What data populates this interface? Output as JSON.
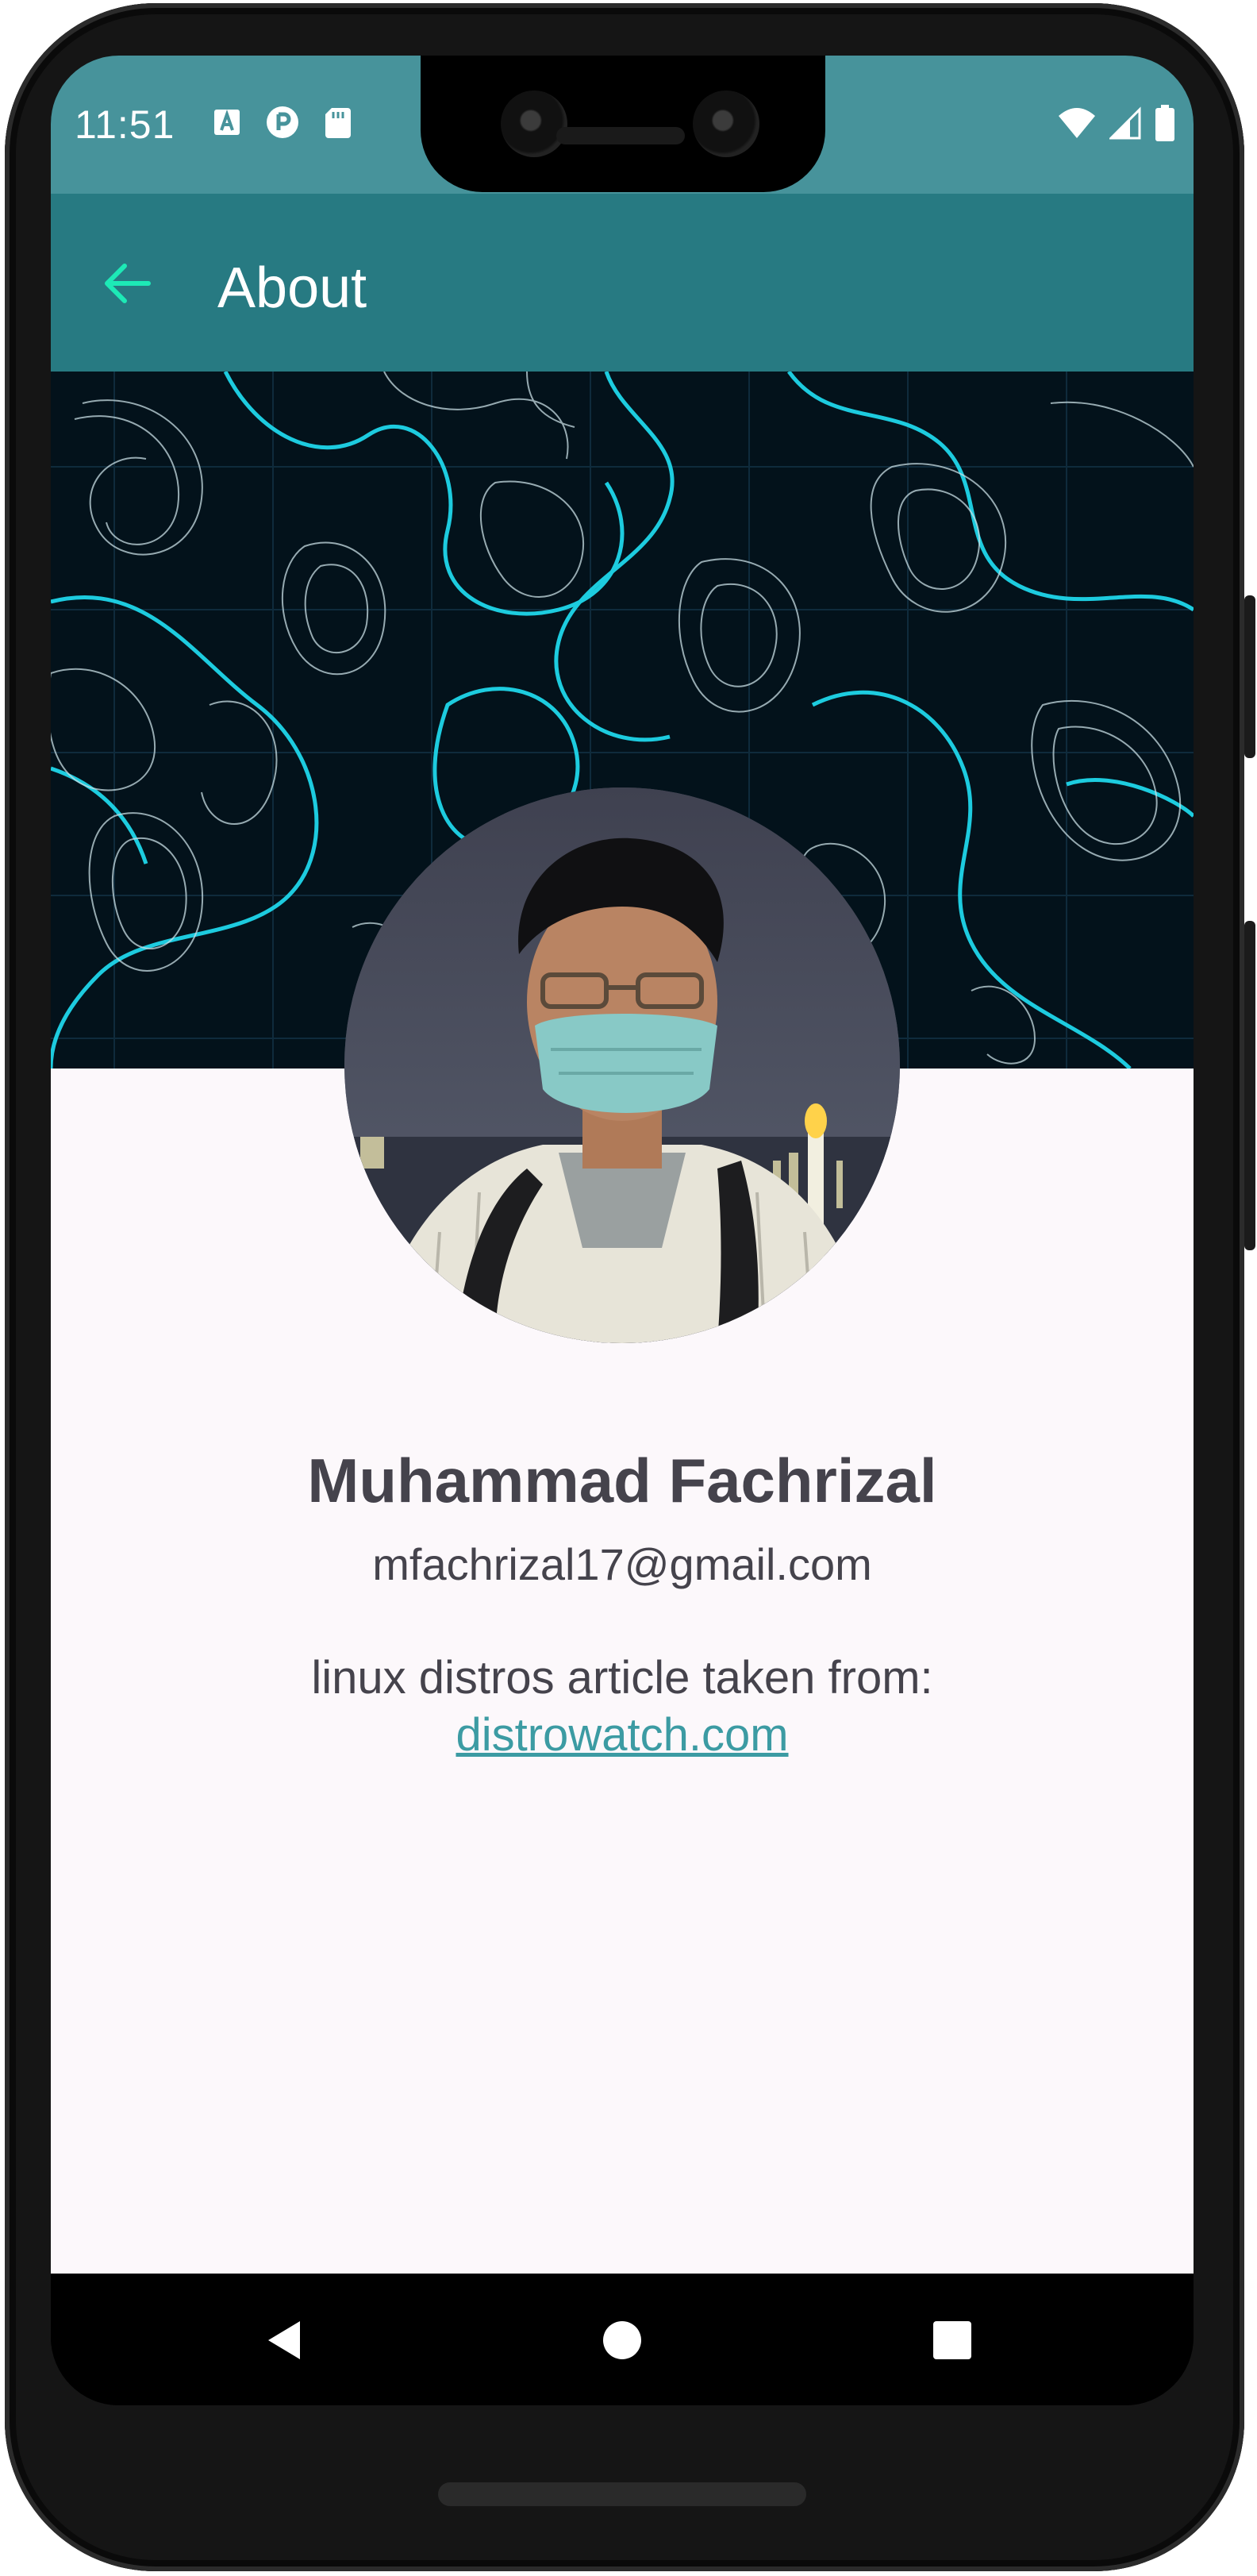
{
  "status_bar": {
    "time": "11:51",
    "left_icons": [
      "a-icon",
      "circle-p-icon",
      "sd-card-icon"
    ],
    "right_icons": [
      "wifi-icon",
      "signal-icon",
      "battery-icon"
    ]
  },
  "app_bar": {
    "title": "About",
    "back_icon": "arrow-left-icon",
    "back_color": "#1de9b6",
    "background": "#277a82"
  },
  "profile": {
    "name": "Muhammad Fachrizal",
    "email": "mfachrizal17@gmail.com",
    "credit_text": "linux distros article taken from:",
    "credit_link": "distrowatch.com",
    "link_color": "#3c9ba3",
    "avatar_alt": "profile photo"
  },
  "nav_bar": {
    "buttons": [
      "back-triangle-icon",
      "home-circle-icon",
      "recents-square-icon"
    ]
  },
  "colors": {
    "status_bar": "#47939b",
    "banner_lines": "#1fd6ea",
    "content_bg": "#fcf8fb",
    "text": "#45434c"
  }
}
